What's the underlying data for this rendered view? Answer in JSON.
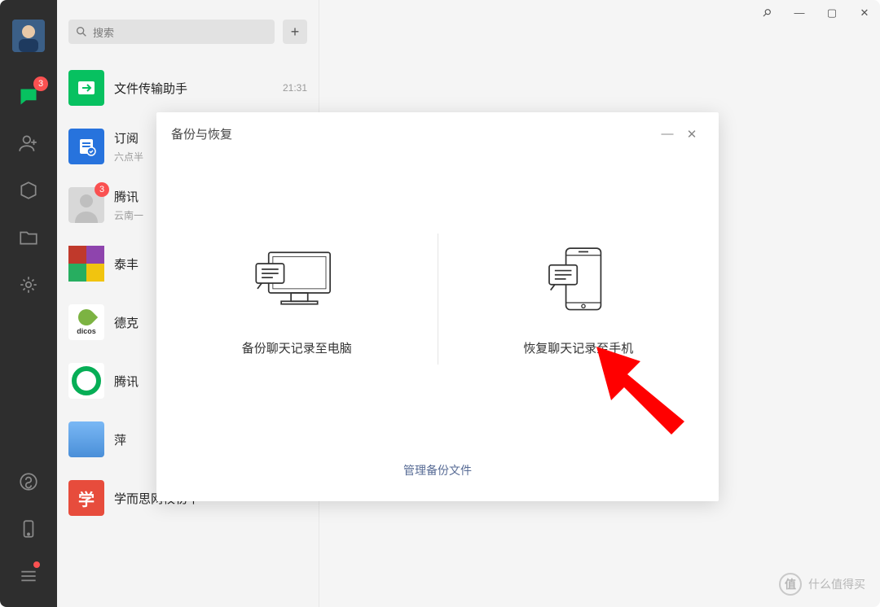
{
  "nav": {
    "chat_badge": "3",
    "more_has_dot": true
  },
  "search": {
    "placeholder": "搜索",
    "add_label": "+"
  },
  "chats": [
    {
      "title": "文件传输助手",
      "sub": "",
      "time": "21:31",
      "badge": ""
    },
    {
      "title": "订阅",
      "sub": "六点半",
      "time": "",
      "badge": ""
    },
    {
      "title": "腾讯",
      "sub": "云南一",
      "time": "",
      "badge": "3"
    },
    {
      "title": "泰丰",
      "sub": "",
      "time": "",
      "badge": ""
    },
    {
      "title": "德克",
      "sub": "",
      "time": "",
      "badge": ""
    },
    {
      "title": "腾讯",
      "sub": "",
      "time": "",
      "badge": ""
    },
    {
      "title": "萍",
      "sub": "",
      "time": "",
      "badge": ""
    },
    {
      "title": "学而思网校初中",
      "sub": "",
      "time": "",
      "badge": ""
    }
  ],
  "avatar_letter": "学",
  "dicos_text": "dicos",
  "modal": {
    "title": "备份与恢复",
    "backup_label": "备份聊天记录至电脑",
    "restore_label": "恢复聊天记录至手机",
    "manage_link": "管理备份文件"
  },
  "window": {
    "pin": "⚲",
    "min": "—",
    "max": "▢",
    "close": "✕"
  },
  "watermark": {
    "logo": "值",
    "text": "什么值得买"
  },
  "colors": {
    "accent": "#07c160",
    "badge": "#fa5151",
    "link": "#576b95",
    "arrow": "#ff0000"
  }
}
